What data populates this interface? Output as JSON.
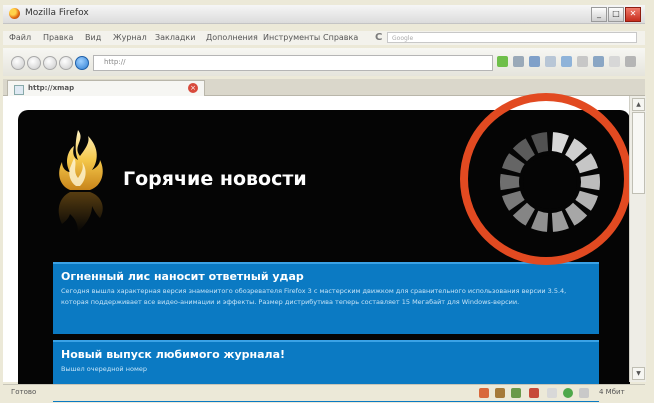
{
  "window": {
    "title": "Mozilla Firefox"
  },
  "menu": {
    "items": [
      "Файл",
      "Правка",
      "Вид",
      "Журнал",
      "Закладки",
      "Дополнения",
      "Инструменты",
      "Справка"
    ],
    "search_placeholder": "Google"
  },
  "nav": {
    "url": "http://"
  },
  "tabs": [
    {
      "label": "http://xmap"
    }
  ],
  "page": {
    "site_title": "Горячие новости",
    "news": [
      {
        "title": "Огненный лис наносит ответный удар",
        "text": "Сегодня вышла характерная версия знаменитого обозревателя Firefox 3 с мастерским движком для сравнительного использования версии 3.5.4, которая поддерживает все видео-анимации и эффекты. Размер дистрибутива теперь составляет 15 Мегабайт для Windows-версии."
      },
      {
        "title": "Новый выпуск любимого журнала!",
        "text": "Вышел очередной номер"
      }
    ]
  },
  "status": {
    "text": "Готово",
    "right": "4 Мбит"
  },
  "colors": {
    "accent_ring": "#e24a21",
    "card_blue": "#0b7ac3",
    "page_bg": "#050505"
  }
}
